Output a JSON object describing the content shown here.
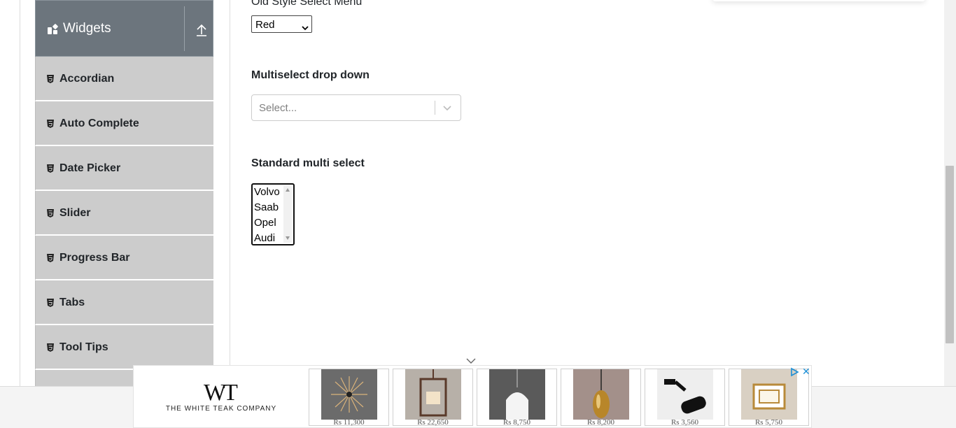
{
  "sidebar": {
    "group_title": "Widgets",
    "group_icon": "widgets-grid-icon",
    "toggle_icon": "collapse-up-arrow-icon",
    "items": [
      {
        "label": "Accordian",
        "icon": "html5-icon"
      },
      {
        "label": "Auto Complete",
        "icon": "html5-icon"
      },
      {
        "label": "Date Picker",
        "icon": "html5-icon"
      },
      {
        "label": "Slider",
        "icon": "html5-icon"
      },
      {
        "label": "Progress Bar",
        "icon": "html5-icon"
      },
      {
        "label": "Tabs",
        "icon": "html5-icon"
      },
      {
        "label": "Tool Tips",
        "icon": "html5-icon"
      }
    ]
  },
  "content": {
    "old_select": {
      "label": "Old Style Select Menu",
      "value": "Red"
    },
    "multiselect_dropdown": {
      "label": "Multiselect drop down",
      "placeholder": "Select..."
    },
    "standard_multi": {
      "label": "Standard multi select",
      "options": [
        "Volvo",
        "Saab",
        "Opel",
        "Audi"
      ]
    }
  },
  "ad": {
    "brand_mark": "WT",
    "brand_name": "THE WHITE TEAK COMPANY",
    "products": [
      {
        "price": "Rs 11,300",
        "color": "#6b6b6b"
      },
      {
        "price": "Rs 22,650",
        "color": "#b7b0a8"
      },
      {
        "price": "Rs 8,750",
        "color": "#5a5a5a"
      },
      {
        "price": "Rs 8,200",
        "color": "#a3908a"
      },
      {
        "price": "Rs 3,560",
        "color": "#eeeeee"
      },
      {
        "price": "Rs 5,750",
        "color": "#d9d0c3"
      }
    ],
    "adchoices_icon": "adchoices-icon",
    "close_icon": "close-icon"
  },
  "colors": {
    "sidebar_header": "#6c757d",
    "sidebar_item": "#cccccc",
    "ad_accent": "#1c8fd6"
  }
}
